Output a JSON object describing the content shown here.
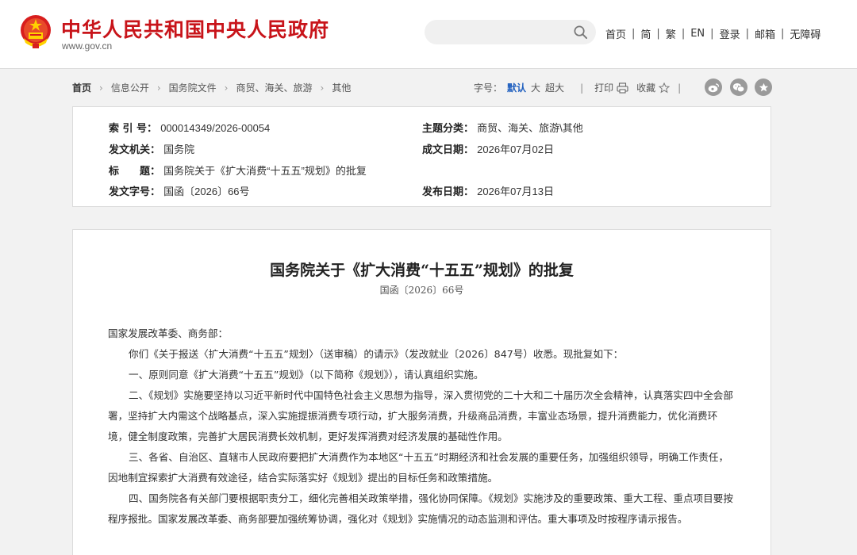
{
  "site": {
    "title": "中华人民共和国中央人民政府",
    "url": "www.gov.cn"
  },
  "search": {
    "placeholder": "",
    "value": ""
  },
  "topnav": {
    "items": [
      "首页",
      "简",
      "繁",
      "EN",
      "登录",
      "邮箱",
      "无障碍"
    ],
    "separator": "|"
  },
  "breadcrumb": {
    "items": [
      "首页",
      "信息公开",
      "国务院文件",
      "商贸、海关、旅游",
      "其他"
    ],
    "separator": "›"
  },
  "tools": {
    "fontsize_label": "字号：",
    "fontsize_options": [
      "默认",
      "大",
      "超大"
    ],
    "fontsize_active": "默认",
    "print_label": "打印",
    "favorite_label": "收藏",
    "separator": "|"
  },
  "share": {
    "icons": [
      "weibo-icon",
      "wechat-icon",
      "star-icon"
    ]
  },
  "meta": {
    "index_label": "索 引 号：",
    "index_value": "000014349/2026-00054",
    "topic_label": "主题分类：",
    "topic_value": "商贸、海关、旅游\\其他",
    "issuer_label": "发文机关：",
    "issuer_value": "国务院",
    "created_label": "成文日期：",
    "created_value": "2026年07月02日",
    "title_label": "标　　题：",
    "title_value": "国务院关于《扩大消费“十五五”规划》的批复",
    "docno_label": "发文字号：",
    "docno_value": "国函〔2026〕66号",
    "published_label": "发布日期：",
    "published_value": "2026年07月13日"
  },
  "article": {
    "title": "国务院关于《扩大消费“十五五”规划》的批复",
    "docno": "国函〔2026〕66号",
    "salutation": "国家发展改革委、商务部：",
    "paragraphs": [
      "你们《关于报送〈扩大消费“十五五”规划〉（送审稿）的请示》（发改就业〔2026〕847号）收悉。现批复如下：",
      "一、原则同意《扩大消费“十五五”规划》（以下简称《规划》），请认真组织实施。",
      "二、《规划》实施要坚持以习近平新时代中国特色社会主义思想为指导，深入贯彻党的二十大和二十届历次全会精神，认真落实四中全会部署，坚持扩大内需这个战略基点，深入实施提振消费专项行动，扩大服务消费，升级商品消费，丰富业态场景，提升消费能力，优化消费环境，健全制度政策，完善扩大居民消费长效机制，更好发挥消费对经济发展的基础性作用。",
      "三、各省、自治区、直辖市人民政府要把扩大消费作为本地区“十五五”时期经济和社会发展的重要任务，加强组织领导，明确工作责任，因地制宜探索扩大消费有效途径，结合实际落实好《规划》提出的目标任务和政策措施。",
      "四、国务院各有关部门要根据职责分工，细化完善相关政策举措，强化协同保障。《规划》实施涉及的重要政策、重大工程、重点项目要按程序报批。国家发展改革委、商务部要加强统筹协调，强化对《规划》实施情况的动态监测和评估。重大事项及时按程序请示报告。"
    ]
  },
  "colors": {
    "brand_red": "#c8141a",
    "active_blue": "#1f5fbf"
  }
}
